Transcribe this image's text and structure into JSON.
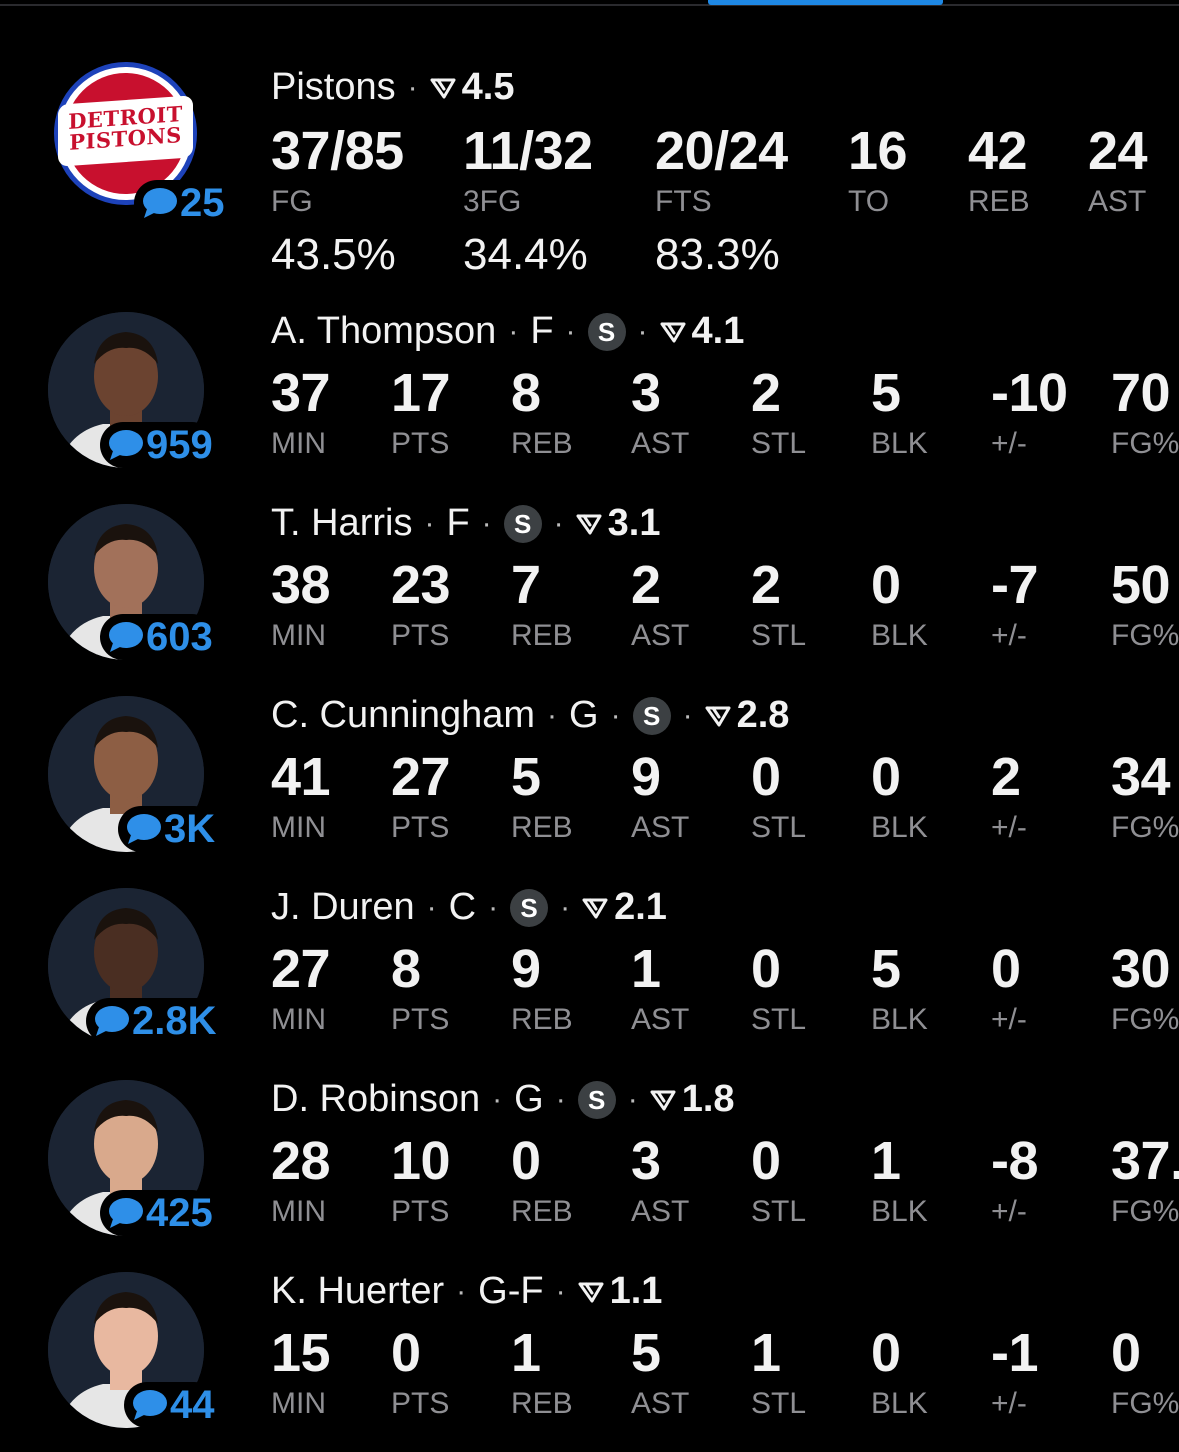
{
  "team": {
    "name": "Pistons",
    "rating": "4.5",
    "logo_text": [
      "DETROIT",
      "PISTONS"
    ],
    "comments": "25",
    "stats": [
      {
        "value": "37/85",
        "label": "FG"
      },
      {
        "value": "11/32",
        "label": "3FG"
      },
      {
        "value": "20/24",
        "label": "FTS"
      },
      {
        "value": "16",
        "label": "TO"
      },
      {
        "value": "42",
        "label": "REB"
      },
      {
        "value": "24",
        "label": "AST"
      }
    ],
    "percentages": [
      "43.5%",
      "34.4%",
      "83.3%"
    ]
  },
  "players": [
    {
      "name": "A. Thompson",
      "position": "F",
      "starter": "S",
      "rating": "4.1",
      "comments": "959",
      "avatar_skin": "#6b4330",
      "stats": [
        {
          "value": "37",
          "label": "MIN"
        },
        {
          "value": "17",
          "label": "PTS"
        },
        {
          "value": "8",
          "label": "REB"
        },
        {
          "value": "3",
          "label": "AST"
        },
        {
          "value": "2",
          "label": "STL"
        },
        {
          "value": "5",
          "label": "BLK"
        },
        {
          "value": "-10",
          "label": "+/-"
        },
        {
          "value": "70",
          "label": "FG%"
        }
      ]
    },
    {
      "name": "T. Harris",
      "position": "F",
      "starter": "S",
      "rating": "3.1",
      "comments": "603",
      "avatar_skin": "#a2715a",
      "stats": [
        {
          "value": "38",
          "label": "MIN"
        },
        {
          "value": "23",
          "label": "PTS"
        },
        {
          "value": "7",
          "label": "REB"
        },
        {
          "value": "2",
          "label": "AST"
        },
        {
          "value": "2",
          "label": "STL"
        },
        {
          "value": "0",
          "label": "BLK"
        },
        {
          "value": "-7",
          "label": "+/-"
        },
        {
          "value": "50",
          "label": "FG%"
        }
      ]
    },
    {
      "name": "C. Cunningham",
      "position": "G",
      "starter": "S",
      "rating": "2.8",
      "comments": "3K",
      "avatar_skin": "#8d5e44",
      "stats": [
        {
          "value": "41",
          "label": "MIN"
        },
        {
          "value": "27",
          "label": "PTS"
        },
        {
          "value": "5",
          "label": "REB"
        },
        {
          "value": "9",
          "label": "AST"
        },
        {
          "value": "0",
          "label": "STL"
        },
        {
          "value": "0",
          "label": "BLK"
        },
        {
          "value": "2",
          "label": "+/-"
        },
        {
          "value": "34",
          "label": "FG%"
        }
      ]
    },
    {
      "name": "J. Duren",
      "position": "C",
      "starter": "S",
      "rating": "2.1",
      "comments": "2.8K",
      "avatar_skin": "#4a2e22",
      "stats": [
        {
          "value": "27",
          "label": "MIN"
        },
        {
          "value": "8",
          "label": "PTS"
        },
        {
          "value": "9",
          "label": "REB"
        },
        {
          "value": "1",
          "label": "AST"
        },
        {
          "value": "0",
          "label": "STL"
        },
        {
          "value": "5",
          "label": "BLK"
        },
        {
          "value": "0",
          "label": "+/-"
        },
        {
          "value": "30",
          "label": "FG%"
        }
      ]
    },
    {
      "name": "D. Robinson",
      "position": "G",
      "starter": "S",
      "rating": "1.8",
      "comments": "425",
      "avatar_skin": "#d9a98c",
      "stats": [
        {
          "value": "28",
          "label": "MIN"
        },
        {
          "value": "10",
          "label": "PTS"
        },
        {
          "value": "0",
          "label": "REB"
        },
        {
          "value": "3",
          "label": "AST"
        },
        {
          "value": "0",
          "label": "STL"
        },
        {
          "value": "1",
          "label": "BLK"
        },
        {
          "value": "-8",
          "label": "+/-"
        },
        {
          "value": "37.",
          "label": "FG%"
        }
      ]
    },
    {
      "name": "K. Huerter",
      "position": "G-F",
      "starter": "",
      "rating": "1.1",
      "comments": "44",
      "avatar_skin": "#e8b8a0",
      "stats": [
        {
          "value": "15",
          "label": "MIN"
        },
        {
          "value": "0",
          "label": "PTS"
        },
        {
          "value": "1",
          "label": "REB"
        },
        {
          "value": "5",
          "label": "AST"
        },
        {
          "value": "1",
          "label": "STL"
        },
        {
          "value": "0",
          "label": "BLK"
        },
        {
          "value": "-1",
          "label": "+/-"
        },
        {
          "value": "0",
          "label": "FG%"
        }
      ]
    }
  ],
  "colors": {
    "accent": "#2e8fe8",
    "negative": "#e53935",
    "positive": "#34a853"
  }
}
